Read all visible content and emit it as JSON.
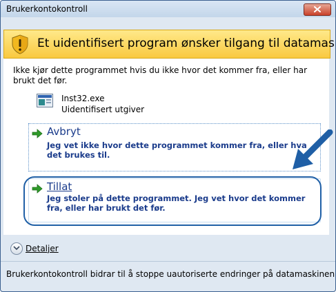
{
  "window": {
    "title": "Brukerkontokontroll"
  },
  "banner": {
    "text": "Et uidentifisert program ønsker tilgang til datamaskinen"
  },
  "content": {
    "warning": "Ikke kjør dette programmet hvis du ikke hvor det kommer fra, eller har brukt det før.",
    "program": {
      "name": "Inst32.exe",
      "publisher": "Uidentifisert utgiver"
    }
  },
  "options": {
    "cancel": {
      "title": "Avbryt",
      "description": "Jeg vet ikke hvor dette programmet kommer fra, eller hva det brukes til."
    },
    "allow": {
      "title": "Tillat",
      "description": "Jeg stoler på dette programmet. Jeg vet hvor det kommer fra, eller har brukt det før."
    }
  },
  "details": {
    "label": "Detaljer"
  },
  "footer": {
    "text": "Brukerkontokontroll bidrar til å stoppe uautoriserte endringer på datamaskinen."
  },
  "colors": {
    "banner_yellow": "#f9c940",
    "link_blue": "#1a3b8b",
    "arrow_green": "#2f9a2a",
    "annotation_blue": "#1f5fa6",
    "close_red": "#c9412a"
  },
  "icons": {
    "close": "close-icon",
    "shield": "shield-warning-icon",
    "program": "program-icon",
    "option_arrow": "green-arrow-icon",
    "details": "chevron-down-icon"
  }
}
